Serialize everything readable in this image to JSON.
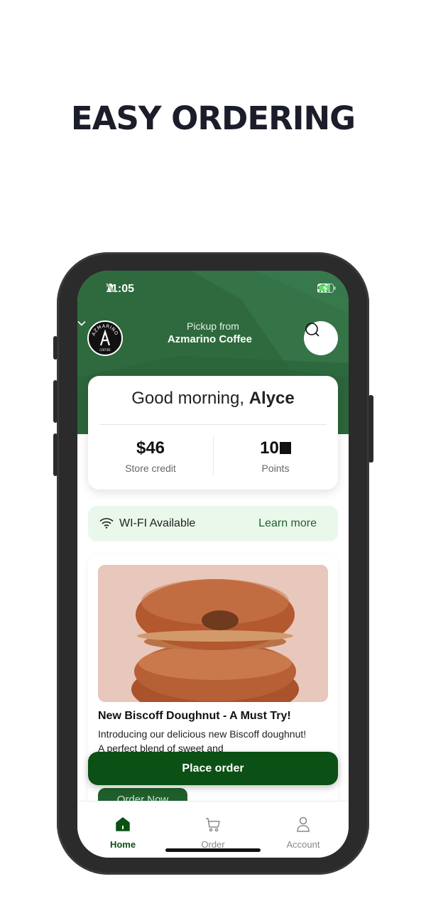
{
  "headline": "EASY ORDERING",
  "status_bar": {
    "time": "11:05"
  },
  "header": {
    "pickup_label": "Pickup from",
    "store_name": "Azmarino Coffee",
    "logo_text": "AZMARINO",
    "logo_sub": "COFFEE"
  },
  "greeting": {
    "prefix": "Good morning, ",
    "name": "Alyce"
  },
  "stats": {
    "credit_value": "$46",
    "credit_label": "Store credit",
    "points_value": "10",
    "points_label": "Points"
  },
  "wifi": {
    "label": "WI-FI Available",
    "link": "Learn more"
  },
  "promo": {
    "title": "New Biscoff Doughnut - A Must Try!",
    "description": "Introducing our delicious new Biscoff doughnut! A perfect blend of sweet and",
    "button": "Order Now"
  },
  "place_order": "Place order",
  "tabs": [
    {
      "label": "Home",
      "icon": "home-icon",
      "active": true
    },
    {
      "label": "Order",
      "icon": "cart-icon",
      "active": false
    },
    {
      "label": "Account",
      "icon": "person-icon",
      "active": false
    }
  ],
  "colors": {
    "brand_green": "#2e6a3d",
    "button_green": "#0b5014",
    "wifi_bg": "#eaf8ec"
  }
}
